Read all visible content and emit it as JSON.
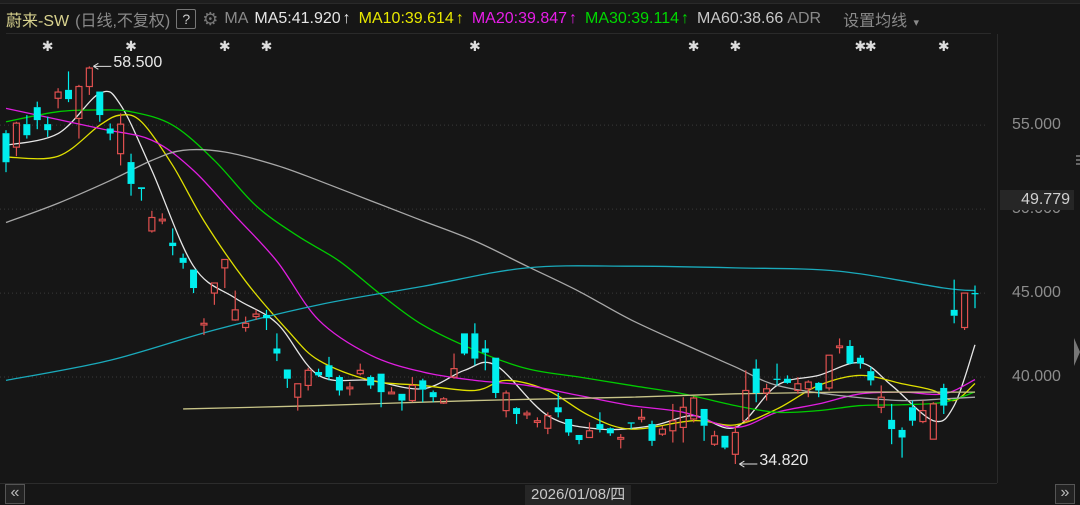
{
  "header": {
    "title": "蔚来-SW",
    "period": "(日线,不复权)",
    "help": "?",
    "ma_label": "MA",
    "ma_values": [
      {
        "text": "MA5:41.920",
        "arrow": "↑",
        "color": "#e6e6e6"
      },
      {
        "text": "MA10:39.614",
        "arrow": "↑",
        "color": "#e8e800"
      },
      {
        "text": "MA20:39.847",
        "arrow": "↑",
        "color": "#e81ee8"
      },
      {
        "text": "MA30:39.114",
        "arrow": "↑",
        "color": "#00d800"
      },
      {
        "text": "MA60:38.66",
        "arrow": "",
        "color": "#c8c8c8"
      }
    ],
    "adr": "ADR",
    "settings": "设置均线",
    "settings_caret": "▾",
    "gear_icon": "gear-icon"
  },
  "markers": {
    "symbol": "✱",
    "candle_index": [
      4,
      12,
      21,
      25,
      45,
      66,
      70,
      82,
      83,
      90
    ]
  },
  "xaxis": {
    "cursor_date": "2026/01/08/四",
    "left_btn": "«",
    "right_btn": "»"
  },
  "chart_data": {
    "type": "candlestick",
    "ylim": [
      33.69,
      60.07
    ],
    "yticks": [
      {
        "v": 55,
        "label": "55.000"
      },
      {
        "v": 50,
        "label": "50.000"
      },
      {
        "v": 45,
        "label": "45.000"
      },
      {
        "v": 40,
        "label": "40.000"
      }
    ],
    "grid": "horizontal dotted",
    "current_price_tag": "49.779",
    "high_label": {
      "value": 58.5,
      "text": "58.500",
      "index": 8
    },
    "low_label": {
      "value": 34.82,
      "text": "34.820",
      "index": 70
    },
    "colors": {
      "up": "#e0504f",
      "down": "#00eeee",
      "background": "#161616"
    },
    "candles_ohlc": [
      [
        54.52,
        54.7,
        52.2,
        52.79
      ],
      [
        53.69,
        55.2,
        53.15,
        55.12
      ],
      [
        55.06,
        55.6,
        54.2,
        54.4
      ],
      [
        56.07,
        56.4,
        54.76,
        55.3
      ],
      [
        55.06,
        55.5,
        54.3,
        54.7
      ],
      [
        56.6,
        57.2,
        56.0,
        56.97
      ],
      [
        57.1,
        58.2,
        56.37,
        56.55
      ],
      [
        55.4,
        57.4,
        54.2,
        57.3
      ],
      [
        57.3,
        58.5,
        56.8,
        58.4
      ],
      [
        57.0,
        57.0,
        55.2,
        55.6
      ],
      [
        54.8,
        55.1,
        54.1,
        54.5
      ],
      [
        53.3,
        55.7,
        52.6,
        55.06
      ],
      [
        52.8,
        53.3,
        50.8,
        51.5
      ],
      [
        51.3,
        51.3,
        50.5,
        51.2
      ],
      [
        48.7,
        49.9,
        48.6,
        49.5
      ],
      [
        49.3,
        49.75,
        49.1,
        49.4
      ],
      [
        48.0,
        48.85,
        47.25,
        47.8
      ],
      [
        47.1,
        47.35,
        46.45,
        46.8
      ],
      [
        46.4,
        46.4,
        45.0,
        45.3
      ],
      [
        43.1,
        43.5,
        42.5,
        43.2
      ],
      [
        45.0,
        45.6,
        44.3,
        45.6
      ],
      [
        46.5,
        47.0,
        45.3,
        47.0
      ],
      [
        43.4,
        45.15,
        43.35,
        44.0
      ],
      [
        42.95,
        43.6,
        42.7,
        43.2
      ],
      [
        43.6,
        44.0,
        43.4,
        43.75
      ],
      [
        43.7,
        44.0,
        42.8,
        43.5
      ],
      [
        41.7,
        42.6,
        40.95,
        41.4
      ],
      [
        40.45,
        40.45,
        39.35,
        39.9
      ],
      [
        38.8,
        39.6,
        38.0,
        39.6
      ],
      [
        39.5,
        40.55,
        39.2,
        40.4
      ],
      [
        40.3,
        40.5,
        40.0,
        40.1
      ],
      [
        40.7,
        41.2,
        39.8,
        40.0
      ],
      [
        40.0,
        40.1,
        38.9,
        39.2
      ],
      [
        39.3,
        39.7,
        38.9,
        39.4
      ],
      [
        40.2,
        40.8,
        40.1,
        40.4
      ],
      [
        40.0,
        40.1,
        39.3,
        39.5
      ],
      [
        40.2,
        40.2,
        38.2,
        39.1
      ],
      [
        39.0,
        39.4,
        39.0,
        39.1
      ],
      [
        39.0,
        39.0,
        38.0,
        38.6
      ],
      [
        38.6,
        40.0,
        38.5,
        39.5
      ],
      [
        39.8,
        39.9,
        38.5,
        39.25
      ],
      [
        39.1,
        39.2,
        38.5,
        38.8
      ],
      [
        38.45,
        38.8,
        38.4,
        38.7
      ],
      [
        40.0,
        41.4,
        39.9,
        40.5
      ],
      [
        42.6,
        42.6,
        41.3,
        41.4
      ],
      [
        42.6,
        43.2,
        40.7,
        41.1
      ],
      [
        41.7,
        42.2,
        40.4,
        41.45
      ],
      [
        41.15,
        41.15,
        38.75,
        39.05
      ],
      [
        38.0,
        39.2,
        37.6,
        39.05
      ],
      [
        38.15,
        38.2,
        37.2,
        37.8
      ],
      [
        37.75,
        38.0,
        37.5,
        37.85
      ],
      [
        37.3,
        37.6,
        37.0,
        37.4
      ],
      [
        36.95,
        37.9,
        36.6,
        37.7
      ],
      [
        38.2,
        39.05,
        37.6,
        37.9
      ],
      [
        37.5,
        37.5,
        36.5,
        36.7
      ],
      [
        36.55,
        36.55,
        36.0,
        36.25
      ],
      [
        36.4,
        37.3,
        36.4,
        36.8
      ],
      [
        37.2,
        37.9,
        36.7,
        36.9
      ],
      [
        36.95,
        37.0,
        36.5,
        36.65
      ],
      [
        36.3,
        36.6,
        35.75,
        36.4
      ],
      [
        37.3,
        37.3,
        36.9,
        37.25
      ],
      [
        37.5,
        38.1,
        37.3,
        37.6
      ],
      [
        37.2,
        37.4,
        35.9,
        36.2
      ],
      [
        36.6,
        37.1,
        36.5,
        36.9
      ],
      [
        36.8,
        38.4,
        36.1,
        37.4
      ],
      [
        37.0,
        38.8,
        36.1,
        38.2
      ],
      [
        37.5,
        38.85,
        37.3,
        38.75
      ],
      [
        38.1,
        38.1,
        36.2,
        37.1
      ],
      [
        36.0,
        36.8,
        35.9,
        36.5
      ],
      [
        36.5,
        36.5,
        35.7,
        35.8
      ],
      [
        35.4,
        37.1,
        34.82,
        36.7
      ],
      [
        37.4,
        40.4,
        37.3,
        39.2
      ],
      [
        40.5,
        41.05,
        38.5,
        39.05
      ],
      [
        39.05,
        39.6,
        38.6,
        39.3
      ],
      [
        39.9,
        40.8,
        39.5,
        39.85
      ],
      [
        39.9,
        40.1,
        39.6,
        39.65
      ],
      [
        39.2,
        40.0,
        39.0,
        39.6
      ],
      [
        39.3,
        39.8,
        38.8,
        39.7
      ],
      [
        39.65,
        39.7,
        38.8,
        39.2
      ],
      [
        39.35,
        41.3,
        39.2,
        41.3
      ],
      [
        41.75,
        42.3,
        41.4,
        41.85
      ],
      [
        41.85,
        42.2,
        40.75,
        40.8
      ],
      [
        41.15,
        41.3,
        40.5,
        40.8
      ],
      [
        40.35,
        40.6,
        39.5,
        39.8
      ],
      [
        38.2,
        39.5,
        37.85,
        38.8
      ],
      [
        37.45,
        38.4,
        36.0,
        36.9
      ],
      [
        36.85,
        37.0,
        35.2,
        36.4
      ],
      [
        38.2,
        38.6,
        37.1,
        37.4
      ],
      [
        37.35,
        38.6,
        37.25,
        38.0
      ],
      [
        36.3,
        38.5,
        36.3,
        38.4
      ],
      [
        39.35,
        39.6,
        37.8,
        38.3
      ],
      [
        44.0,
        45.8,
        43.2,
        43.65
      ],
      [
        42.95,
        45.0,
        42.8,
        45.0
      ],
      [
        45.0,
        45.45,
        44.1,
        44.95
      ]
    ],
    "series": [
      {
        "name": "MA5",
        "color": "#e6e6e6",
        "points": [
          [
            0,
            53.8
          ],
          [
            5,
            54.5
          ],
          [
            9,
            56.9
          ],
          [
            11,
            56.2
          ],
          [
            14,
            52.3
          ],
          [
            18,
            46.6
          ],
          [
            22,
            44.7
          ],
          [
            26,
            43.2
          ],
          [
            30,
            40.1
          ],
          [
            35,
            39.8
          ],
          [
            40,
            39.3
          ],
          [
            44,
            40.4
          ],
          [
            47,
            40.7
          ],
          [
            52,
            37.7
          ],
          [
            57,
            36.9
          ],
          [
            62,
            37.1
          ],
          [
            66,
            37.7
          ],
          [
            70,
            37.0
          ],
          [
            74,
            39.5
          ],
          [
            78,
            40.1
          ],
          [
            82,
            40.85
          ],
          [
            85,
            39.5
          ],
          [
            89,
            37.4
          ],
          [
            91,
            38.3
          ],
          [
            93,
            41.92
          ]
        ]
      },
      {
        "name": "MA10",
        "color": "#e0e000",
        "points": [
          [
            0,
            53.1
          ],
          [
            5,
            53.15
          ],
          [
            9,
            55.0
          ],
          [
            11,
            55.6
          ],
          [
            13,
            55.2
          ],
          [
            16,
            52.6
          ],
          [
            19,
            49.3
          ],
          [
            23,
            45.7
          ],
          [
            27,
            42.8
          ],
          [
            30,
            41.0
          ],
          [
            35,
            39.8
          ],
          [
            40,
            39.5
          ],
          [
            45,
            39.2
          ],
          [
            48,
            39.8
          ],
          [
            52,
            39.2
          ],
          [
            56,
            37.7
          ],
          [
            60,
            36.9
          ],
          [
            66,
            37.4
          ],
          [
            70,
            37.15
          ],
          [
            74,
            38.1
          ],
          [
            78,
            39.5
          ],
          [
            82,
            40.1
          ],
          [
            86,
            39.6
          ],
          [
            89,
            39.2
          ],
          [
            91,
            38.6
          ],
          [
            93,
            39.614
          ]
        ]
      },
      {
        "name": "MA20",
        "color": "#e01ee0",
        "points": [
          [
            0,
            56.0
          ],
          [
            9,
            54.8
          ],
          [
            14,
            54.1
          ],
          [
            18,
            52.3
          ],
          [
            22,
            49.6
          ],
          [
            26,
            46.9
          ],
          [
            30,
            43.4
          ],
          [
            35,
            41.3
          ],
          [
            40,
            40.3
          ],
          [
            45,
            39.8
          ],
          [
            50,
            39.5
          ],
          [
            55,
            38.9
          ],
          [
            60,
            38.3
          ],
          [
            65,
            37.9
          ],
          [
            70,
            37.0
          ],
          [
            74,
            37.9
          ],
          [
            78,
            38.4
          ],
          [
            82,
            39.0
          ],
          [
            86,
            39.1
          ],
          [
            90,
            39.0
          ],
          [
            93,
            39.847
          ]
        ]
      },
      {
        "name": "MA30",
        "color": "#00cc00",
        "points": [
          [
            0,
            55.2
          ],
          [
            5,
            55.8
          ],
          [
            9,
            55.9
          ],
          [
            12,
            55.8
          ],
          [
            16,
            55.0
          ],
          [
            20,
            52.9
          ],
          [
            24,
            50.2
          ],
          [
            28,
            48.4
          ],
          [
            32,
            46.9
          ],
          [
            36,
            44.9
          ],
          [
            40,
            43.1
          ],
          [
            45,
            41.6
          ],
          [
            50,
            40.5
          ],
          [
            55,
            40.0
          ],
          [
            60,
            39.5
          ],
          [
            65,
            39.0
          ],
          [
            70,
            38.3
          ],
          [
            74,
            37.9
          ],
          [
            78,
            38.0
          ],
          [
            82,
            38.3
          ],
          [
            86,
            38.35
          ],
          [
            90,
            38.5
          ],
          [
            93,
            39.114
          ]
        ]
      },
      {
        "name": "MA60",
        "color": "#a8a8a8",
        "points": [
          [
            0,
            49.2
          ],
          [
            5,
            50.35
          ],
          [
            10,
            51.7
          ],
          [
            14,
            52.9
          ],
          [
            17,
            53.5
          ],
          [
            21,
            53.4
          ],
          [
            26,
            52.6
          ],
          [
            30,
            51.7
          ],
          [
            35,
            50.5
          ],
          [
            40,
            49.3
          ],
          [
            45,
            48.1
          ],
          [
            50,
            46.6
          ],
          [
            55,
            45.1
          ],
          [
            60,
            43.4
          ],
          [
            66,
            41.7
          ],
          [
            70,
            40.6
          ],
          [
            74,
            39.5
          ],
          [
            80,
            38.9
          ],
          [
            86,
            38.6
          ],
          [
            90,
            38.7
          ],
          [
            93,
            38.8
          ]
        ]
      },
      {
        "color": "#1aaabb",
        "points": [
          [
            0,
            39.8
          ],
          [
            10,
            41.0
          ],
          [
            20,
            42.8
          ],
          [
            30,
            44.3
          ],
          [
            40,
            45.4
          ],
          [
            50,
            46.5
          ],
          [
            60,
            46.6
          ],
          [
            70,
            46.5
          ],
          [
            80,
            46.3
          ],
          [
            90,
            45.3
          ],
          [
            93,
            45.15
          ]
        ]
      },
      {
        "color": "#c8c488",
        "points": [
          [
            17,
            38.1
          ],
          [
            30,
            38.3
          ],
          [
            45,
            38.6
          ],
          [
            60,
            38.8
          ],
          [
            70,
            39.0
          ],
          [
            80,
            39.1
          ],
          [
            90,
            39.1
          ],
          [
            93,
            39.1
          ]
        ]
      }
    ]
  }
}
